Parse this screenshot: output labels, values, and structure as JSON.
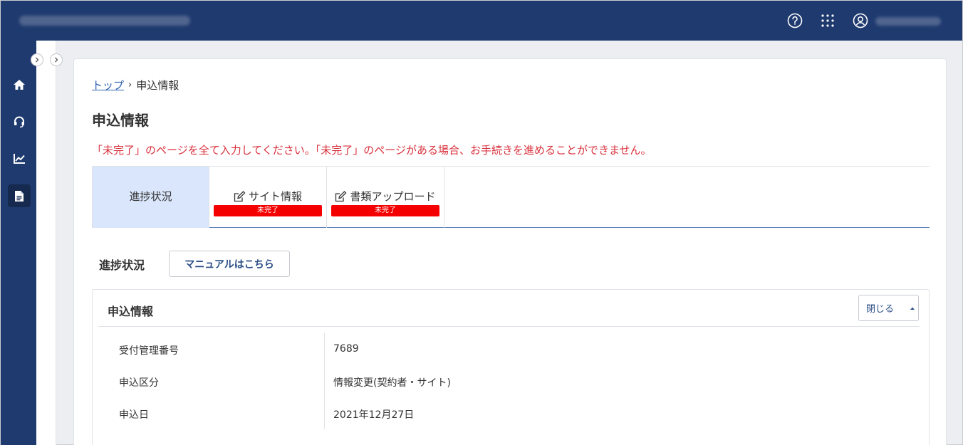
{
  "header": {
    "title_blurred": "",
    "help_icon": "help-circle-icon",
    "apps_icon": "grid-apps-icon",
    "user_icon": "user-icon",
    "user_name_blurred": ""
  },
  "sidebar": {
    "items": [
      {
        "name": "home",
        "icon": "home-icon",
        "active": false
      },
      {
        "name": "support",
        "icon": "headset-icon",
        "active": false
      },
      {
        "name": "analytics",
        "icon": "chart-icon",
        "active": false
      },
      {
        "name": "documents",
        "icon": "document-icon",
        "active": true
      }
    ]
  },
  "breadcrumb": {
    "home": "トップ",
    "separator": "›",
    "current": "申込情報"
  },
  "page": {
    "title": "申込情報",
    "warning": "「未完了」のページを全て入力してください。「未完了」のページがある場合、お手続きを進めることができません。"
  },
  "tabs": [
    {
      "label": "進捗状況",
      "badge": "",
      "active": true
    },
    {
      "label": "サイト情報",
      "badge": "未完了",
      "active": false
    },
    {
      "label": "書類アップロード",
      "badge": "未完了",
      "active": false
    }
  ],
  "progress_section": {
    "heading": "進捗状況",
    "manual_button": "マニュアルはこちら"
  },
  "panel": {
    "title": "申込情報",
    "close_button": "閉じる",
    "rows": [
      {
        "label": "受付管理番号",
        "value": "7689"
      },
      {
        "label": "申込区分",
        "value": "情報変更(契約者・サイト)"
      },
      {
        "label": "申込日",
        "value": "2021年12月27日"
      }
    ]
  },
  "colors": {
    "header_bg": "#1f3a6f",
    "active_tab": "#d9e6fb",
    "warning": "#d9303c",
    "badge": "#f50000",
    "link": "#2c5fae"
  }
}
